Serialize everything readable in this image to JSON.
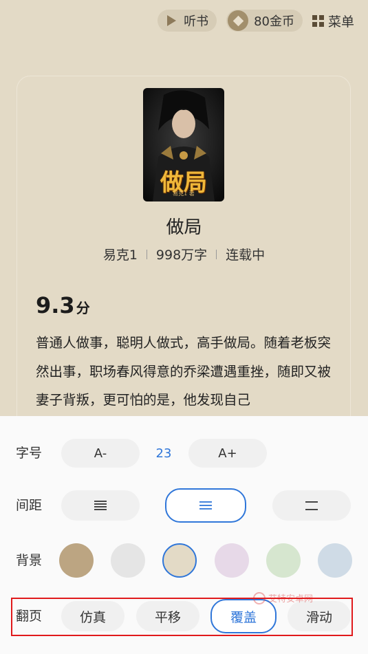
{
  "topbar": {
    "listen_label": "听书",
    "coins_label": "80金币",
    "menu_label": "菜单"
  },
  "book": {
    "cover_title": "做局",
    "cover_subtitle": "易克1 著",
    "title": "做局",
    "author": "易克1",
    "word_count": "998万字",
    "status": "连载中",
    "score": "9.3",
    "score_unit": "分",
    "description": "普通人做事，聪明人做式，高手做局。随着老板突然出事，职场春风得意的乔梁遭遇重挫，随即又被妻子背叛，更可怕的是，他发现自己"
  },
  "settings": {
    "font_size": {
      "label": "字号",
      "decrease_label": "A-",
      "value": "23",
      "increase_label": "A+"
    },
    "spacing": {
      "label": "间距",
      "options": [
        "tight",
        "medium",
        "loose"
      ],
      "selected_index": 1
    },
    "background": {
      "label": "背景",
      "colors": [
        "#bca582",
        "#e5e5e5",
        "#e3dac6",
        "#e7d9e8",
        "#d6e6cf",
        "#cfdbe6"
      ],
      "selected_index": 2
    },
    "page_turn": {
      "label": "翻页",
      "options": [
        "仿真",
        "平移",
        "覆盖",
        "滑动"
      ],
      "selected_index": 2
    }
  },
  "watermark": {
    "text": "艾特安卓网"
  },
  "colors": {
    "accent": "#2f76d9",
    "page_background": "#e3dac6",
    "highlight_box": "#e0191b"
  }
}
